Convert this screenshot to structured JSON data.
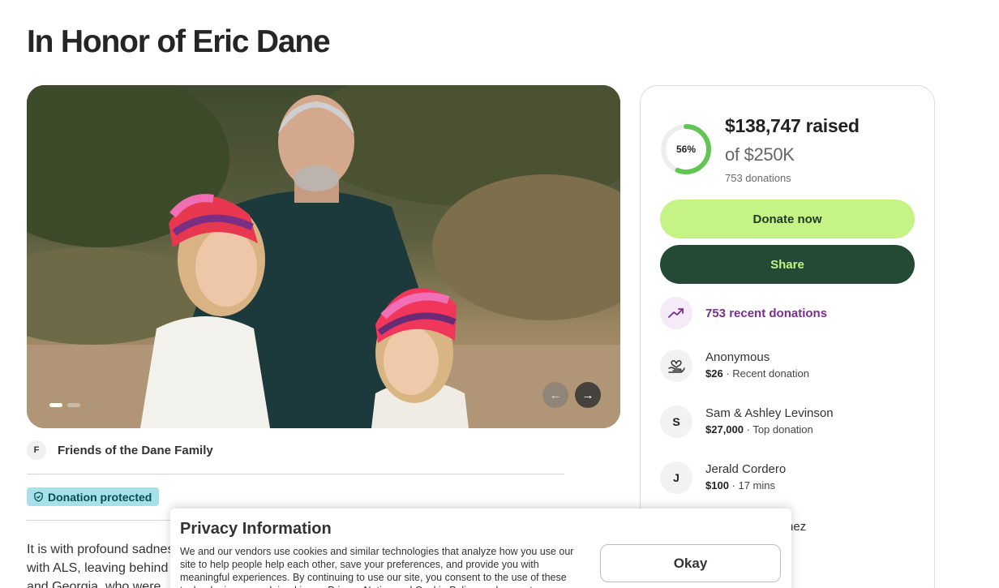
{
  "page": {
    "title": "In Honor of Eric Dane"
  },
  "hero": {
    "alt": "Photo of Eric Dane with his two daughters wearing pink striped knit hats",
    "dot_count": 2,
    "active_dot": 0,
    "prev_icon": "arrow-left-icon",
    "next_icon": "arrow-right-icon"
  },
  "organizer": {
    "initial": "F",
    "name": "Friends of the Dane Family"
  },
  "badge": {
    "icon": "shield-icon",
    "label": "Donation protected"
  },
  "story": {
    "lines": [
      "It is with profound sadness",
      "with ALS, leaving behind",
      "and Georgia, who were"
    ]
  },
  "fundraiser": {
    "raised": "$138,747 raised",
    "goal": "of $250K",
    "donations": "753 donations",
    "percent_label": "56%",
    "progress": 0.56,
    "donate_label": "Donate now",
    "share_label": "Share",
    "recent_icon": "trending-up-icon",
    "recent_label": "753 recent donations"
  },
  "donors": [
    {
      "name": "Anonymous",
      "avatar": "heart-hand-icon",
      "amount": "$26",
      "note": " · Recent donation"
    },
    {
      "name": "Sam & Ashley Levinson",
      "avatar": "S",
      "amount": "$27,000",
      "note": " · Top donation"
    },
    {
      "name": "Jerald Cordero",
      "avatar": "J",
      "amount": "$100",
      "note": " · 17 mins"
    }
  ],
  "partial_donor_name": "nez",
  "privacy": {
    "title": "Privacy Information",
    "text": "We and our vendors use cookies and similar technologies that analyze how you use our site to help people help each other, save your preferences, and provide you with meaningful experiences. By continuing to use our site, you consent to the use of these technologies as explained in our Privacy Notice and Cookie Policy, and agree to our",
    "button": "Okay"
  },
  "colors": {
    "accent_green": "#c5f386",
    "dark_green": "#244a36",
    "ring_green": "#62c553",
    "purple": "#7a2e8e",
    "badge_bg": "#a6e0e8"
  }
}
